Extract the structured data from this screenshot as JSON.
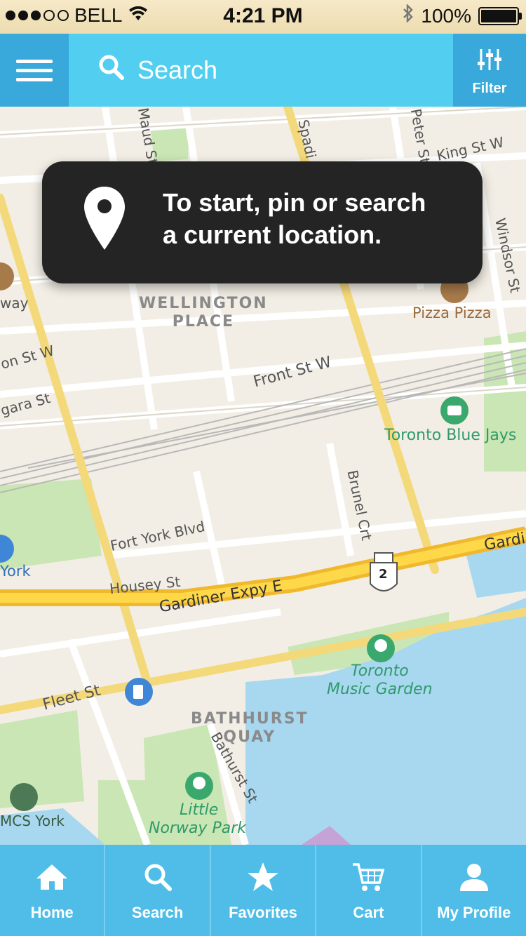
{
  "status_bar": {
    "carrier": "BELL",
    "time": "4:21 PM",
    "battery": "100%"
  },
  "header": {
    "search_label": "Search",
    "filter_label": "Filter"
  },
  "tooltip": {
    "message_line1": "To start, pin or search",
    "message_line2": "a current location."
  },
  "map": {
    "streets": [
      "King St W",
      "Maud St",
      "Spadi",
      "Peter St",
      "Windsor St",
      "Front St W",
      "Brunel Crt",
      "Fort York Blvd",
      "Housey St",
      "Gardiner Expy E",
      "Gardi",
      "Fleet St",
      "Bathurst St",
      "on St W",
      "gara St",
      "way"
    ],
    "districts": [
      "WELLINGTON",
      "PLACE",
      "BATHHURST",
      "QUAY"
    ],
    "pois": [
      "Pizza Pizza",
      "Toronto Blue Jays",
      "Toronto",
      "Music Garden",
      "Little",
      "Norway Park",
      "York",
      "MCS York"
    ],
    "highway_shield": "2"
  },
  "tabs": [
    {
      "label": "Home",
      "icon": "home-icon"
    },
    {
      "label": "Search",
      "icon": "search-icon"
    },
    {
      "label": "Favorites",
      "icon": "star-icon"
    },
    {
      "label": "Cart",
      "icon": "cart-icon"
    },
    {
      "label": "My Profile",
      "icon": "profile-icon"
    }
  ],
  "colors": {
    "header": "#52cff0",
    "header_dark": "#38a9da",
    "tabbar": "#50bde8",
    "tooltip": "#242424",
    "water": "#a8d8f0",
    "park": "#c9e6b4"
  }
}
